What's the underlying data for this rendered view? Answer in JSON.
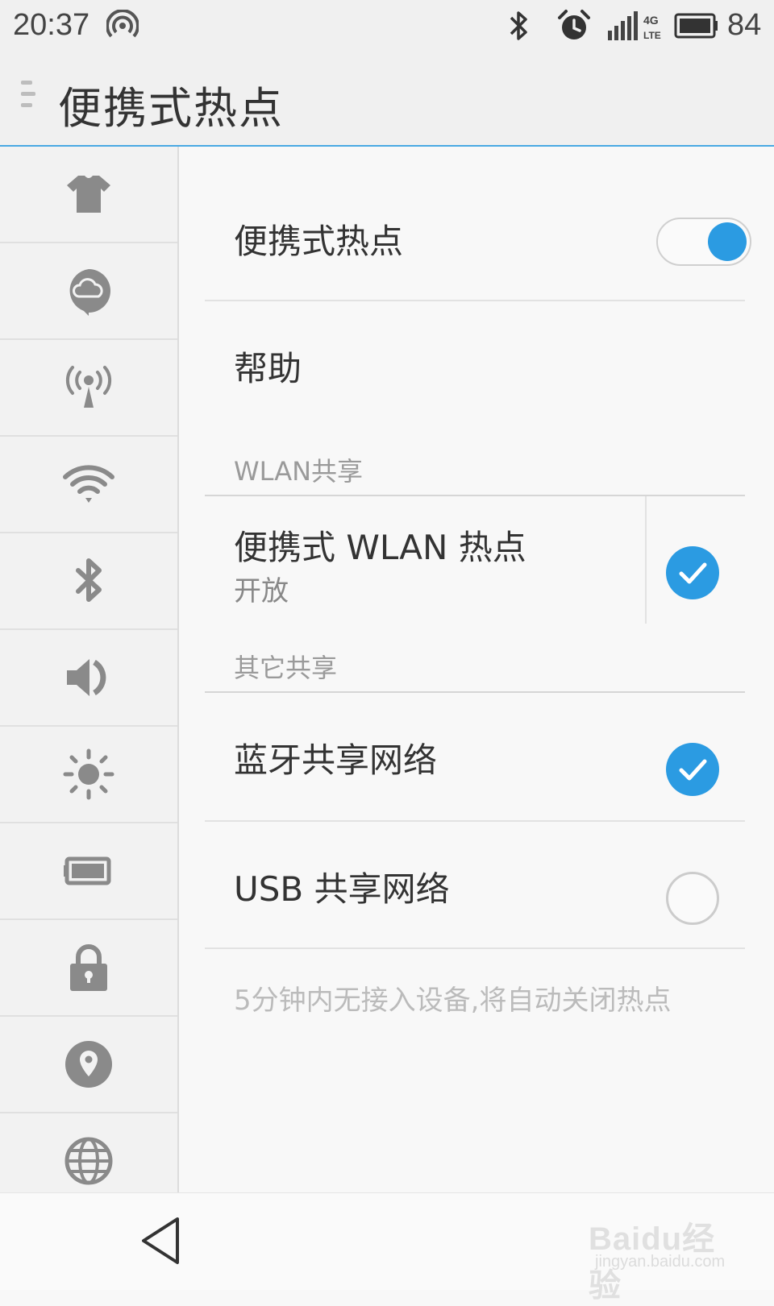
{
  "status": {
    "time": "20:37",
    "battery": "84",
    "network": "4G LTE",
    "icons": [
      "hotspot-icon",
      "bluetooth-icon",
      "alarm-icon",
      "signal-icon",
      "battery-icon"
    ]
  },
  "header": {
    "title": "便携式热点",
    "menu_icon": "menu-icon"
  },
  "sidebar": {
    "items": [
      {
        "icon": "theme-shirt-icon"
      },
      {
        "icon": "cloud-icon"
      },
      {
        "icon": "hotspot-antenna-icon",
        "selected": true
      },
      {
        "icon": "wifi-icon"
      },
      {
        "icon": "bluetooth-icon"
      },
      {
        "icon": "sound-icon"
      },
      {
        "icon": "brightness-icon"
      },
      {
        "icon": "battery-icon"
      },
      {
        "icon": "lock-icon"
      },
      {
        "icon": "location-icon"
      },
      {
        "icon": "globe-icon"
      }
    ]
  },
  "main": {
    "hotspot": {
      "label": "便携式热点",
      "enabled": true
    },
    "help": {
      "label": "帮助"
    },
    "wlan_section": {
      "header": "WLAN共享"
    },
    "wlan_hotspot": {
      "label": "便携式 WLAN 热点",
      "sub": "开放",
      "checked": true
    },
    "other_section": {
      "header": "其它共享"
    },
    "bt_share": {
      "label": "蓝牙共享网络",
      "checked": true
    },
    "usb_share": {
      "label": "USB 共享网络",
      "checked": false
    },
    "hint": "5分钟内无接入设备,将自动关闭热点"
  },
  "nav": {
    "back_icon": "back-triangle-icon"
  },
  "watermark": {
    "logo": "Baidu经验",
    "url": "jingyan.baidu.com"
  },
  "colors": {
    "accent": "#2b9be2",
    "title_underline": "#49a9e3",
    "icon_gray": "#8a8a8a"
  }
}
